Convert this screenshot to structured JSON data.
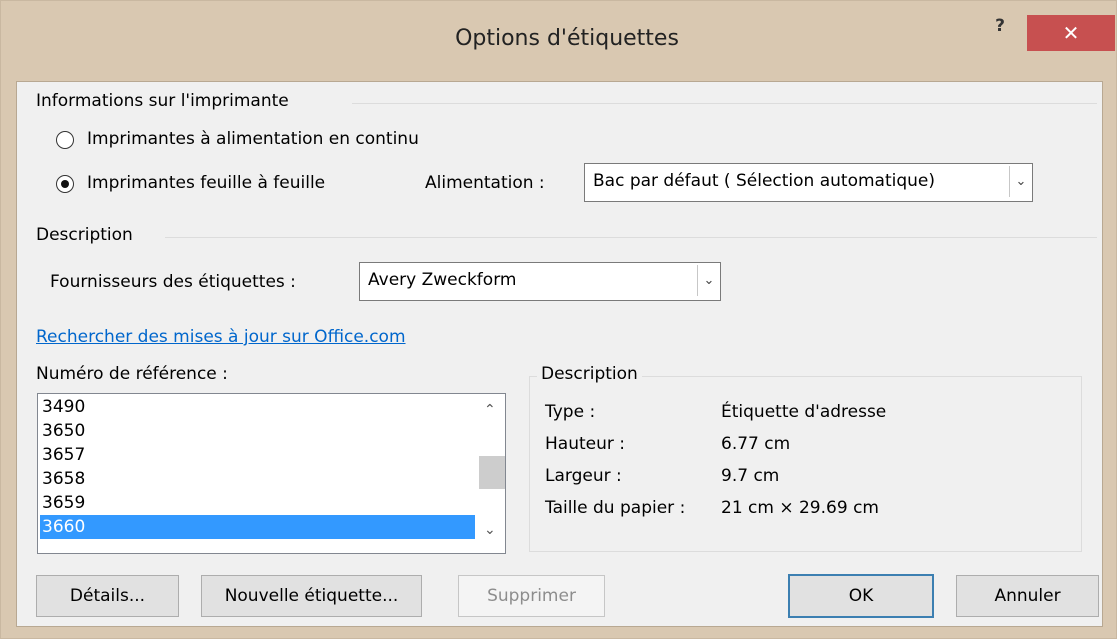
{
  "window": {
    "title": "Options d'étiquettes",
    "help_label": "?",
    "close_label": "✕"
  },
  "printer_info": {
    "heading": "Informations sur l'imprimante",
    "continuous_label": "Imprimantes à alimentation en continu",
    "page_printers_label": "Imprimantes feuille à feuille",
    "selected": "page_printers",
    "tray_label": "Alimentation :",
    "tray_value": "Bac par défaut ( Sélection automatique)"
  },
  "description_section": {
    "heading": "Description",
    "vendor_label": "Fournisseurs des étiquettes :",
    "vendor_value": "Avery Zweckform"
  },
  "update_link": "Rechercher des mises à jour sur Office.com",
  "product_number": {
    "label": "Numéro de référence :",
    "items": [
      "3490",
      "3650",
      "3657",
      "3658",
      "3659",
      "3660"
    ],
    "selected": "3660"
  },
  "details_box": {
    "heading": "Description",
    "rows": [
      {
        "key": "Type :",
        "value": "Étiquette d'adresse"
      },
      {
        "key": "Hauteur :",
        "value": "6.77 cm"
      },
      {
        "key": "Largeur :",
        "value": "9.7 cm"
      },
      {
        "key": "Taille du papier :",
        "value": "21 cm × 29.69 cm"
      }
    ]
  },
  "buttons": {
    "details": "Détails...",
    "new_label": "Nouvelle étiquette...",
    "delete": "Supprimer",
    "ok": "OK",
    "cancel": "Annuler"
  },
  "colors": {
    "titlebar": "#d9c8b1",
    "close": "#c75050",
    "selection": "#3399ff",
    "link": "#0066cc"
  }
}
